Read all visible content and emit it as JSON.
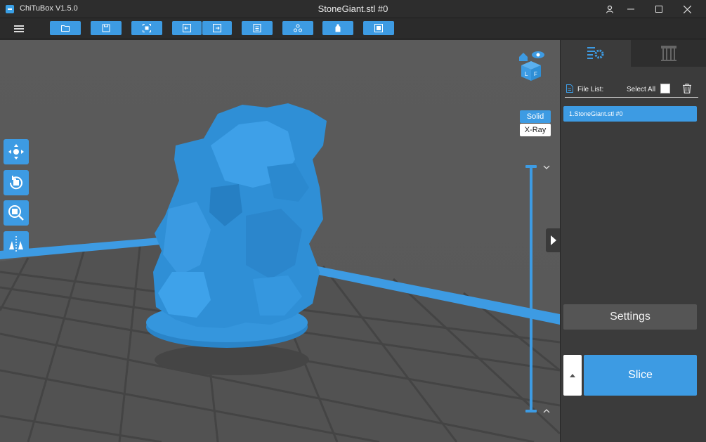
{
  "window": {
    "app_title": "ChiTuBox V1.5.0",
    "doc_title": "StoneGiant.stl #0"
  },
  "toolbar": {
    "buttons": [
      {
        "name": "open-file-icon"
      },
      {
        "name": "save-icon"
      },
      {
        "name": "screenshot-icon"
      },
      {
        "name": "undo-icon"
      },
      {
        "name": "redo-icon"
      },
      {
        "name": "notes-icon"
      },
      {
        "name": "network-icon"
      },
      {
        "name": "resin-icon"
      },
      {
        "name": "machine-icon"
      }
    ]
  },
  "viewport": {
    "solid_label": "Solid",
    "xray_label": "X-Ray",
    "tools": [
      "move-icon",
      "rotate-icon",
      "scale-icon",
      "mirror-icon"
    ]
  },
  "right_panel": {
    "file_list_label": "File List:",
    "select_all_label": "Select All",
    "files": [
      "1.StoneGiant.stl #0"
    ],
    "settings_label": "Settings",
    "slice_label": "Slice"
  },
  "colors": {
    "accent": "#3d9be3",
    "model": "#2f8fd6",
    "viewport_bg": "#5a5a5a",
    "panel_bg": "#3b3b3b"
  }
}
